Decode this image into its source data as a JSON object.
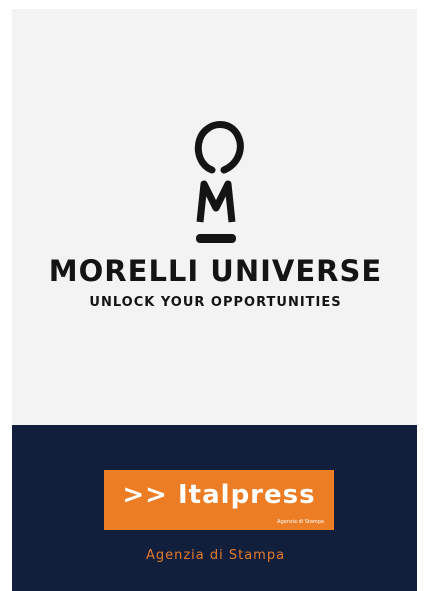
{
  "brand": {
    "name": "MORELLI UNIVERSE",
    "tagline": "UNLOCK YOUR OPPORTUNITIES",
    "logo_icon": "keyhole-m-logo-icon"
  },
  "footer": {
    "logo_text": ">> Italpress",
    "logo_subtext": "Agenzia di Stampa",
    "agency_label": "Agenzia di Stampa",
    "bar_color": "#121f3c",
    "logo_color": "#ed7d25"
  }
}
